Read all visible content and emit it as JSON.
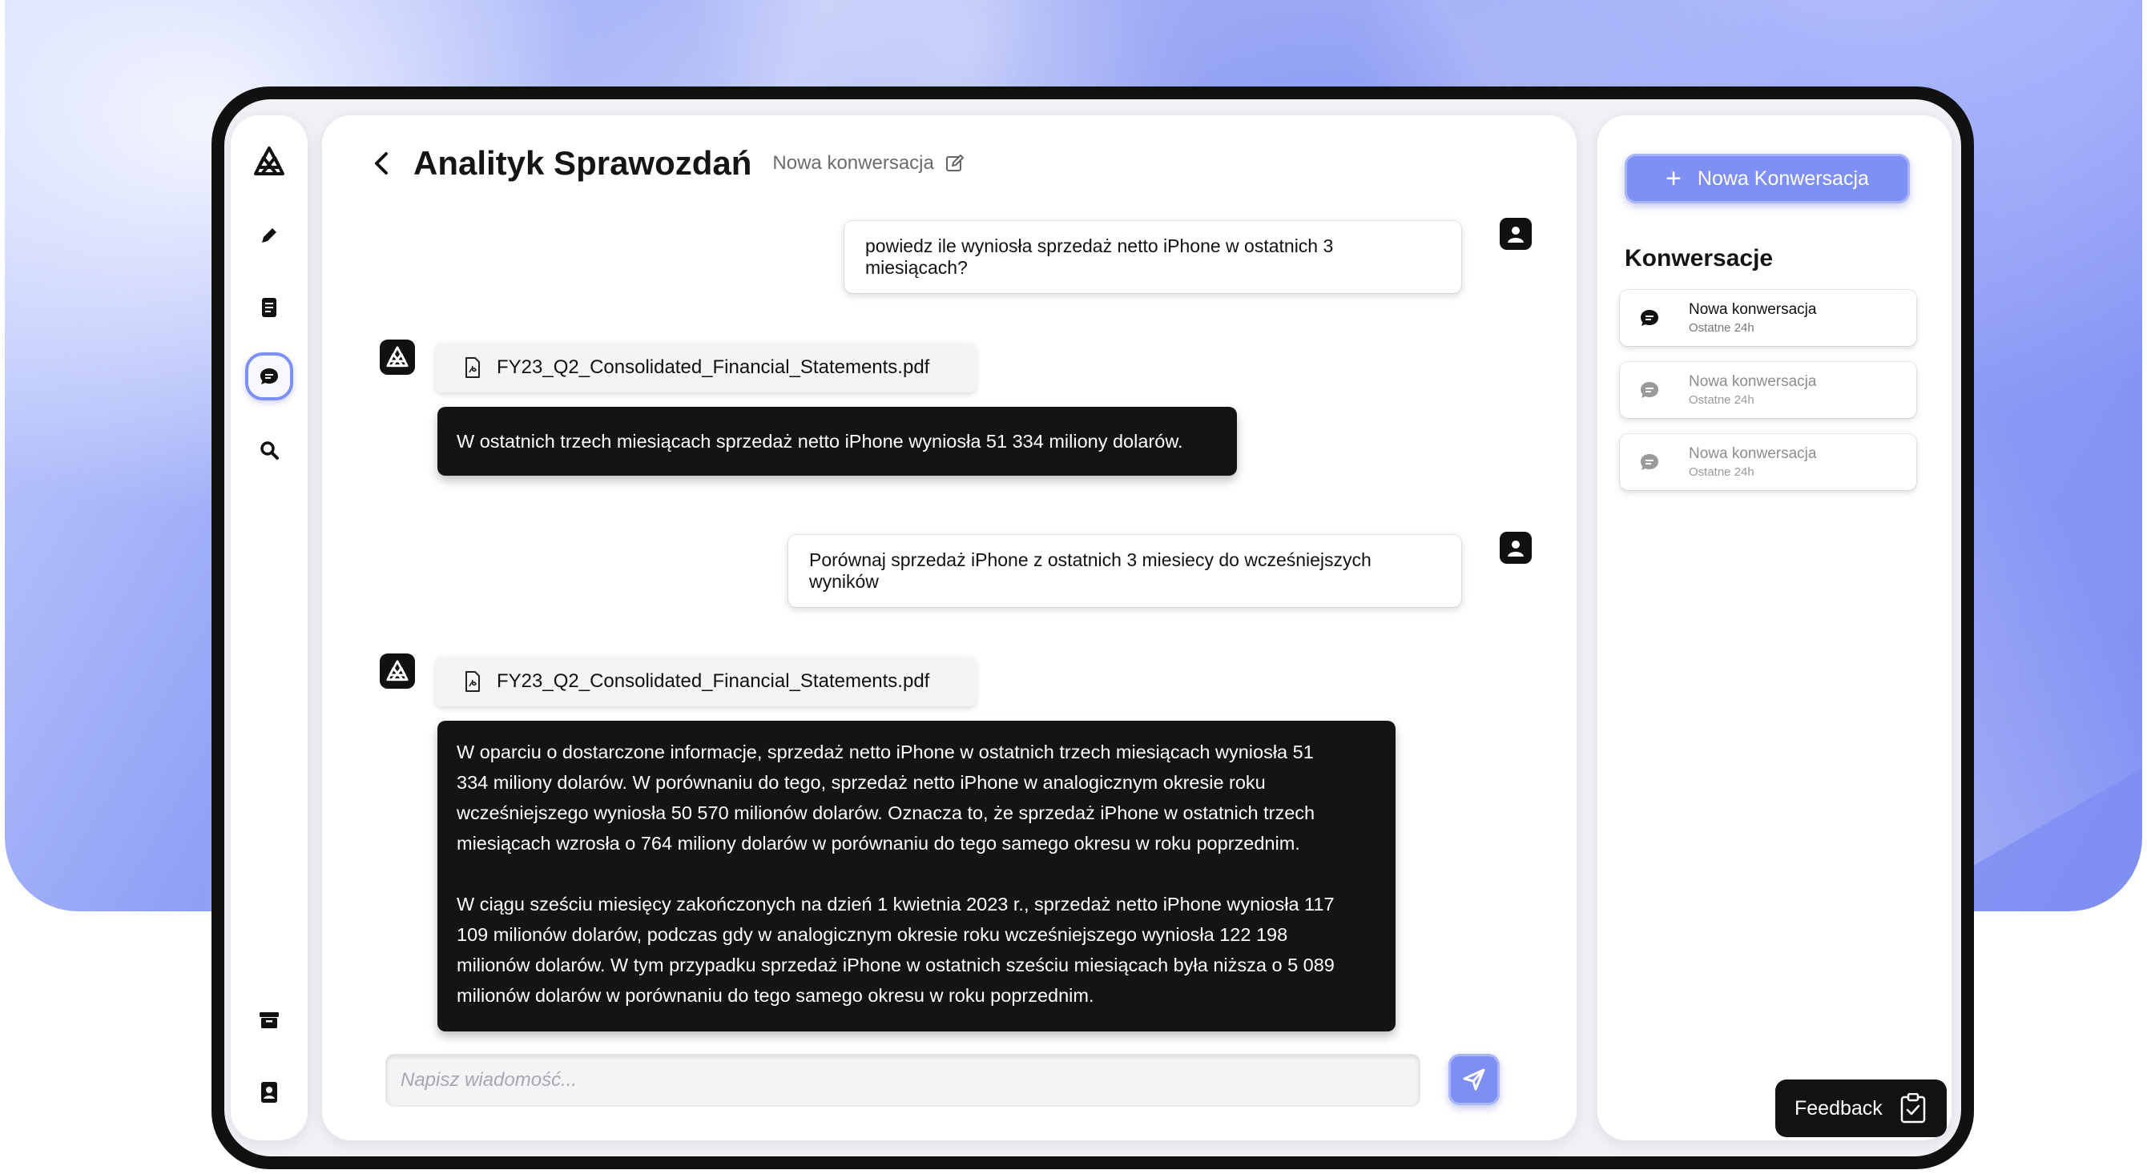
{
  "header": {
    "title": "Analityk Sprawozdań",
    "conversation_name": "Nowa konwersacja"
  },
  "sidebar": {
    "items": [
      {
        "icon": "logo-icon"
      },
      {
        "icon": "pencil-icon"
      },
      {
        "icon": "document-icon"
      },
      {
        "icon": "chat-bubble-icon",
        "active": true
      },
      {
        "icon": "search-icon"
      },
      {
        "icon": "archive-icon"
      },
      {
        "icon": "contacts-icon"
      }
    ]
  },
  "messages": {
    "user_1": "powiedz ile wyniosła sprzedaż netto iPhone w ostatnich 3 miesiącach?",
    "file_1": "FY23_Q2_Consolidated_Financial_Statements.pdf",
    "bot_1": "W ostatnich trzech miesiącach sprzedaż netto iPhone wyniosła 51 334 miliony dolarów.",
    "user_2": "Porównaj sprzedaż iPhone z ostatnich 3 miesiecy do wcześniejszych wyników",
    "file_2": "FY23_Q2_Consolidated_Financial_Statements.pdf",
    "bot_2_lines": [
      "W oparciu o dostarczone informacje, sprzedaż netto iPhone w ostatnich trzech miesiącach wyniosła 51",
      "334 miliony dolarów. W porównaniu do tego, sprzedaż netto iPhone w analogicznym okresie roku",
      "wcześniejszego wyniosła 50 570 milionów dolarów. Oznacza to, że sprzedaż iPhone w ostatnich trzech",
      "miesiącach wzrosła o 764 miliony dolarów w porównaniu do tego samego okresu w roku poprzednim.",
      "",
      "W ciągu sześciu miesięcy zakończonych na dzień 1 kwietnia 2023 r., sprzedaż netto iPhone wyniosła 117",
      "109 milionów dolarów, podczas gdy w analogicznym okresie roku wcześniejszego wyniosła 122 198",
      "milionów dolarów. W tym przypadku sprzedaż iPhone w ostatnich sześciu miesiącach była niższa o 5 089",
      "milionów dolarów w porównaniu do tego samego okresu w roku poprzednim."
    ]
  },
  "input": {
    "placeholder": "Napisz wiadomość..."
  },
  "right_panel": {
    "new_button_label": "Nowa Konwersacja",
    "section_title": "Konwersacje",
    "conversations": [
      {
        "title": "Nowa konwersacja",
        "subtitle": "Ostatne 24h",
        "active": true
      },
      {
        "title": "Nowa konwersacja",
        "subtitle": "Ostatne 24h",
        "active": false
      },
      {
        "title": "Nowa konwersacja",
        "subtitle": "Ostatne 24h",
        "active": false
      }
    ]
  },
  "feedback_label": "Feedback",
  "colors": {
    "accent": "#7d8ff2",
    "bubble_dark": "#141414",
    "text_primary": "#151515"
  }
}
